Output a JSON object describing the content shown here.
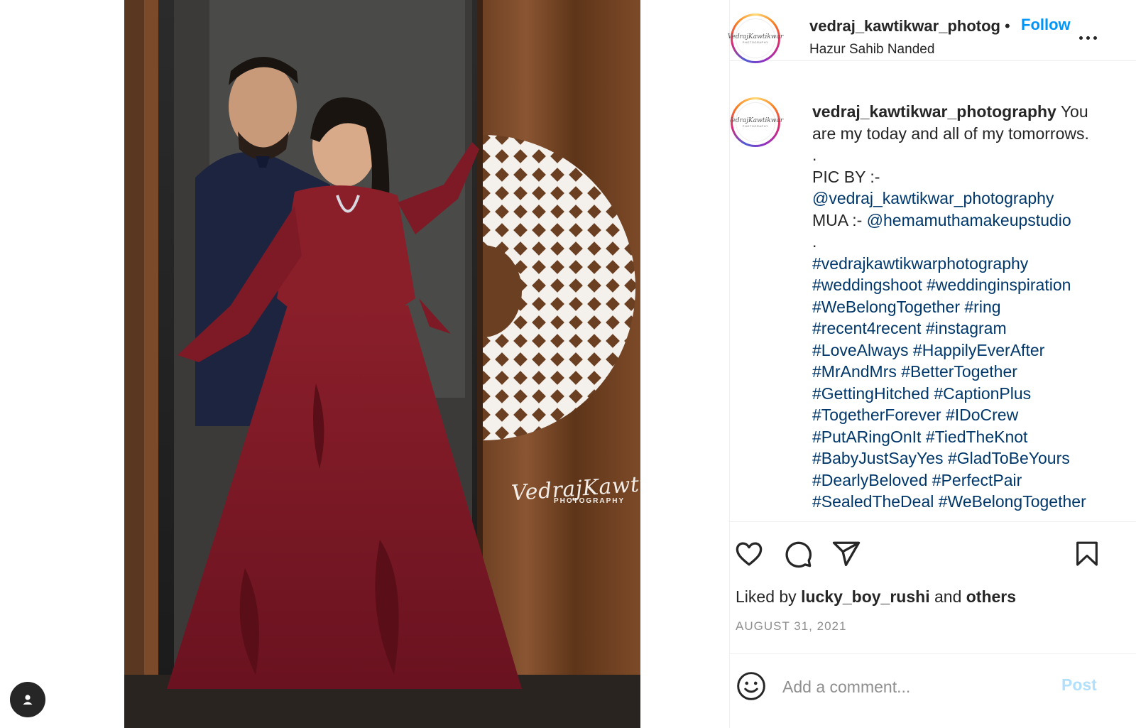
{
  "photo": {
    "alt": "Wedding couple portrait in doorway",
    "watermark_main": "VedrajKawtikwar",
    "watermark_sub": "PHOTOGRAPHY"
  },
  "header": {
    "username": "vedraj_kawtikwar_photography",
    "separator": "•",
    "follow_label": "Follow",
    "location": "Hazur Sahib Nanded",
    "avatar_logo_text": "VedrajKawtikwar",
    "avatar_logo_sub": "PHOTOGRAPHY"
  },
  "caption": {
    "username": "vedraj_kawtikwar_photography",
    "text_first": "You",
    "text_line2": "are my today and all of my tomorrows.",
    "dot1": ".",
    "pic_by": "PIC BY :-",
    "pic_by_mention": "@vedraj_kawtikwar_photography",
    "mua_label": "MUA :- ",
    "mua_mention": "@hemamuthamakeupstudio",
    "dot2": ".",
    "hashtag_lines": [
      [
        "#vedrajkawtikwarphotography"
      ],
      [
        "#weddingshoot",
        "#weddinginspiration"
      ],
      [
        "#WeBelongTogether",
        "#ring"
      ],
      [
        "#recent4recent",
        "#instagram"
      ],
      [
        "#LoveAlways",
        "#HappilyEverAfter"
      ],
      [
        "#MrAndMrs",
        "#BetterTogether"
      ],
      [
        "#GettingHitched",
        "#CaptionPlus"
      ],
      [
        "#TogetherForever",
        "#IDoCrew"
      ],
      [
        "#PutARingOnIt",
        "#TiedTheKnot"
      ],
      [
        "#BabyJustSayYes",
        "#GladToBeYours"
      ],
      [
        "#DearlyBeloved",
        "#PerfectPair"
      ],
      [
        "#SealedTheDeal",
        "#WeBelongTogether"
      ]
    ]
  },
  "actions": {
    "icons": [
      "heart-icon",
      "comment-icon",
      "share-icon",
      "bookmark-icon"
    ],
    "liked_prefix": "Liked by ",
    "liked_user": "lucky_boy_rushi",
    "liked_and": " and ",
    "liked_others": "others",
    "date": "AUGUST 31, 2021"
  },
  "comment": {
    "placeholder": "Add a comment...",
    "post_label": "Post"
  },
  "colors": {
    "follow": "#0095f6",
    "hashtag": "#00376b",
    "post_disabled": "#b2dffc",
    "muted": "#8e8e8e",
    "text": "#262626"
  }
}
